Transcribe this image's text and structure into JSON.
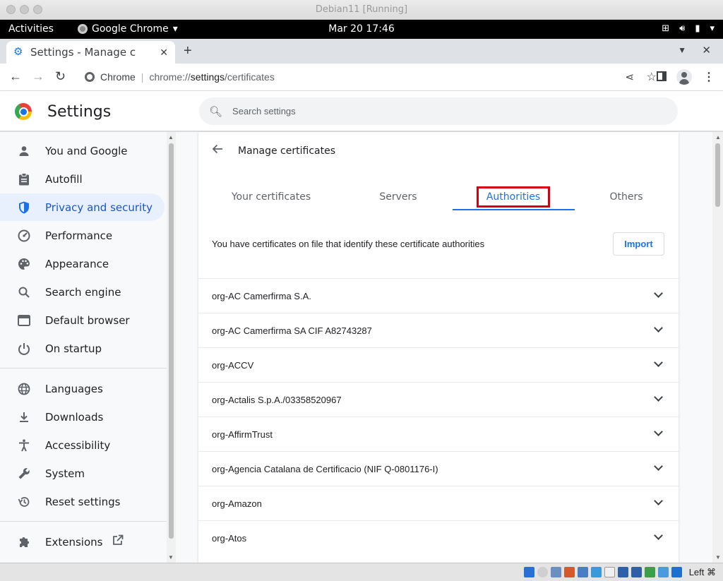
{
  "vm": {
    "title": "Debian11 [Running]",
    "host_key": "Left ⌘"
  },
  "gnome": {
    "activities": "Activities",
    "app_name": "Google Chrome",
    "clock": "Mar 20  17:46"
  },
  "browser": {
    "tab_title": "Settings - Manage certific",
    "omnibox": {
      "chip": "Chrome",
      "scheme": "chrome://",
      "host": "settings",
      "path": "/certificates"
    }
  },
  "settings": {
    "title": "Settings",
    "search_placeholder": "Search settings"
  },
  "sidebar": {
    "items": [
      {
        "label": "You and Google",
        "icon": "person-icon"
      },
      {
        "label": "Autofill",
        "icon": "clipboard-icon"
      },
      {
        "label": "Privacy and security",
        "icon": "shield-icon",
        "active": true
      },
      {
        "label": "Performance",
        "icon": "speedometer-icon"
      },
      {
        "label": "Appearance",
        "icon": "palette-icon"
      },
      {
        "label": "Search engine",
        "icon": "search-icon"
      },
      {
        "label": "Default browser",
        "icon": "browser-window-icon"
      },
      {
        "label": "On startup",
        "icon": "power-icon"
      },
      {
        "label": "Languages",
        "icon": "globe-icon"
      },
      {
        "label": "Downloads",
        "icon": "download-icon"
      },
      {
        "label": "Accessibility",
        "icon": "accessibility-icon"
      },
      {
        "label": "System",
        "icon": "wrench-icon"
      },
      {
        "label": "Reset settings",
        "icon": "reset-history-icon"
      },
      {
        "label": "Extensions",
        "icon": "puzzle-icon"
      }
    ]
  },
  "certificates": {
    "title": "Manage certificates",
    "tabs": [
      "Your certificates",
      "Servers",
      "Authorities",
      "Others"
    ],
    "active_tab": "Authorities",
    "description": "You have certificates on file that identify these certificate authorities",
    "import_label": "Import",
    "authorities": [
      "org-AC Camerfirma S.A.",
      "org-AC Camerfirma SA CIF A82743287",
      "org-ACCV",
      "org-Actalis S.p.A./03358520967",
      "org-AffirmTrust",
      "org-Agencia Catalana de Certificacio (NIF Q-0801176-I)",
      "org-Amazon",
      "org-Atos"
    ]
  },
  "colors": {
    "accent": "#1a73e8",
    "highlight_box": "#d40010",
    "active_nav_bg": "#e8f0fe"
  }
}
